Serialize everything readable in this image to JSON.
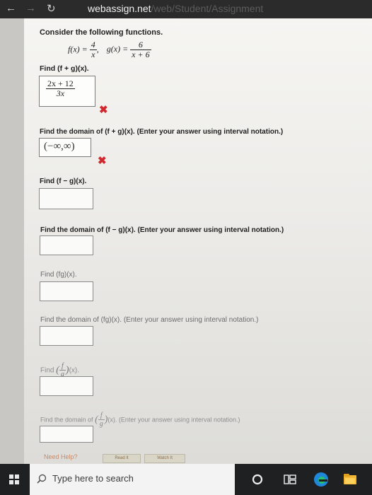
{
  "browser": {
    "url_domain": "webassign.net",
    "url_path": "/web/Student/Assignment"
  },
  "problem": {
    "intro": "Consider the following functions.",
    "f_label": "f(x) = ",
    "f_num": "4",
    "f_den": "x",
    "comma": ",",
    "g_label": "g(x) = ",
    "g_num": "6",
    "g_den": "x + 6",
    "q1": "Find  (f + g)(x).",
    "a1_num": "2x + 12",
    "a1_den": "3x",
    "q2": "Find the domain of  (f + g)(x).  (Enter your answer using interval notation.)",
    "a2_value": "(−∞,∞)",
    "q3": "Find  (f − g)(x).",
    "q4": "Find the domain of  (f − g)(x).  (Enter your answer using interval notation.)",
    "q5": "Find  (fg)(x).",
    "q6": "Find the domain of  (fg)(x).  (Enter your answer using interval notation.)",
    "q7_pre": "Find",
    "q7_post": "(x).",
    "q8_pre": "Find the domain of",
    "q8_post": "(x).  (Enter your answer using interval notation.)",
    "frac_num": "f",
    "frac_den": "g",
    "incorrect_mark": "✖"
  },
  "help": {
    "label": "Need Help?",
    "read_button": "Read It",
    "watch_button": "Watch It"
  },
  "taskbar": {
    "search_placeholder": "Type here to search"
  },
  "colors": {
    "incorrect": "#d2272d",
    "taskbar": "#1f2022"
  }
}
